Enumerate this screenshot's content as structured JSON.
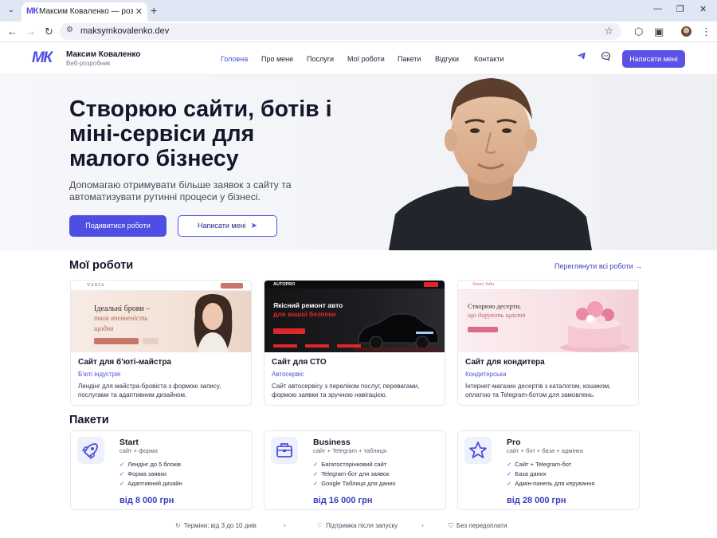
{
  "browser": {
    "tab_title": "Максим Коваленко — розробка",
    "tab_favicon": "МК",
    "url": "maksymkovalenko.dev"
  },
  "header": {
    "logo": "МК",
    "name": "Максим Коваленко",
    "role": "Веб-розробник",
    "nav": [
      "Головна",
      "Про мене",
      "Послуги",
      "Мої роботи",
      "Пакети",
      "Відгуки",
      "Контакти"
    ],
    "cta": "Написати мені",
    "accent_color": "#5a52e6"
  },
  "hero": {
    "title": "Створюю сайти, ботів і міні-сервіси для малого бізнесу",
    "subtitle": "Допомагаю отримувати більше заявок з сайту та автоматизувати рутинні процеси у бізнесі.",
    "primary_button": "Подивитися роботи",
    "secondary_button": "Написати мені"
  },
  "works": {
    "title": "Мої роботи",
    "see_all": "Переглянути всі роботи →",
    "cards": [
      {
        "title": "Сайт для б'юті-майстра",
        "tag": "Б'юті індустрія",
        "desc": "Лендінг для майстра-бровіста з формою запису, послугами та адаптивним дизайном.",
        "preview_brand": "VASIA",
        "preview_headline": "Ідеальні брови –",
        "preview_headline2": "твоя впевненість",
        "preview_headline3": "щодня"
      },
      {
        "title": "Сайт для СТО",
        "tag": "Автосервіс",
        "desc": "Сайт автосервісу з переліком послуг, перевагами, формою заявки та зручною навігацією.",
        "preview_brand": "AUTOPRO",
        "preview_headline": "Якісний ремонт авто",
        "preview_headline2": "для вашої безпеки"
      },
      {
        "title": "Сайт для кондитера",
        "tag": "Кондитерська",
        "desc": "Інтернет-магазин десертів з каталогом, кошиком, оплатою та Telegram-ботом для замовлень.",
        "preview_brand": "Sweet Joba",
        "preview_headline": "Створюю десерти,",
        "preview_headline2": "що дарують щастя"
      }
    ]
  },
  "packages": {
    "title": "Пакети",
    "items": [
      {
        "icon": "rocket-icon",
        "name": "Start",
        "sub": "сайт + форма",
        "features": [
          "Лендінг до 5 блоків",
          "Форма заявки",
          "Адаптивний дизайн"
        ],
        "price": "від 8 000 грн"
      },
      {
        "icon": "briefcase-icon",
        "name": "Business",
        "sub": "сайт + Telegram + таблиця",
        "features": [
          "Багатосторінковий сайт",
          "Telegram-бот для заявок",
          "Google Таблиця для даних"
        ],
        "price": "від 16 000 грн"
      },
      {
        "icon": "star-icon",
        "name": "Pro",
        "sub": "сайт + бот + база + адмінка",
        "features": [
          "Сайт + Telegram-бот",
          "База даних",
          "Адмін-панель для керування"
        ],
        "price": "від 28 000 грн"
      }
    ]
  },
  "footer": {
    "items": [
      "Терміни: від 3 до 10 днів",
      "Підтримка після запуску",
      "Без передоплати"
    ]
  }
}
